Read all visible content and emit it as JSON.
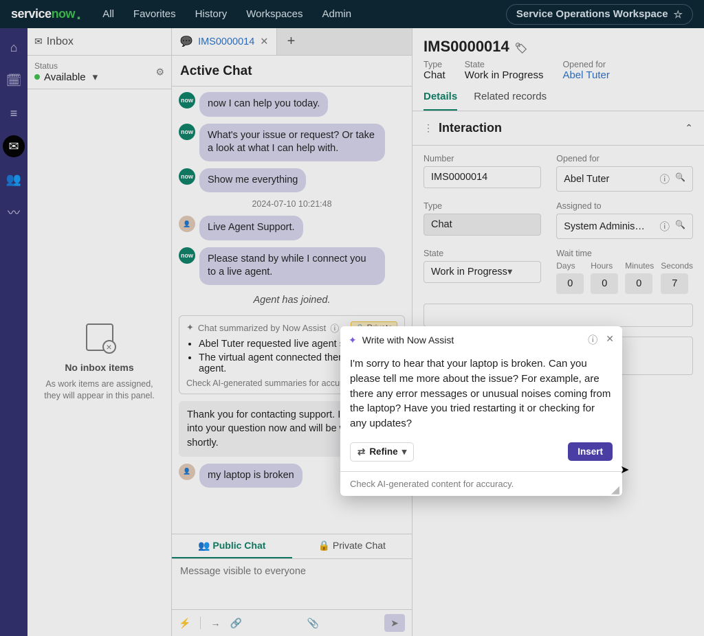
{
  "topnav": {
    "items": [
      "All",
      "Favorites",
      "History",
      "Workspaces",
      "Admin"
    ],
    "workspace_pill": "Service Operations Workspace"
  },
  "inbox": {
    "title": "Inbox",
    "status_label": "Status",
    "status_value": "Available",
    "empty_title": "No inbox items",
    "empty_sub": "As work items are assigned, they will appear in this panel."
  },
  "doctab": {
    "label": "IMS0000014"
  },
  "chat": {
    "header": "Active Chat",
    "msgs": {
      "m0": "now I can help you today.",
      "m1": "What's your issue or request? Or take a look at what I can help with.",
      "m2": "Show me everything",
      "ts": "2024-07-10 10:21:48",
      "m3": "Live Agent Support.",
      "m4": "Please stand by while I connect you to a live agent.",
      "joined": "Agent has joined.",
      "summary_head": "Chat summarized by Now Assist",
      "summary_private": "Private",
      "summary1": "Abel Tuter requested live agent support.",
      "summary2": "The virtual agent connected them to a live agent.",
      "summary_foot": "Check AI-generated summaries for accuracy",
      "m5": "Thank you for contacting support. I am looking into your question now and will be with you shortly.",
      "m6": "my laptop is broken"
    },
    "composer": {
      "tab_public": "Public Chat",
      "tab_private": "Private Chat",
      "placeholder": "Message visible to everyone"
    }
  },
  "record": {
    "title": "IMS0000014",
    "meta": {
      "type_label": "Type",
      "type_value": "Chat",
      "state_label": "State",
      "state_value": "Work in Progress",
      "opened_for_label": "Opened for",
      "opened_for_value": "Abel Tuter"
    },
    "tabs": {
      "details": "Details",
      "related": "Related records"
    },
    "section": "Interaction",
    "fields": {
      "number_label": "Number",
      "number_value": "IMS0000014",
      "opened_for_label": "Opened for",
      "opened_for_value": "Abel Tuter",
      "type_label": "Type",
      "type_value": "Chat",
      "assigned_to_label": "Assigned to",
      "assigned_to_value": "System Administrator",
      "state_label": "State",
      "state_value": "Work in Progress",
      "wait_label": "Wait time",
      "wait": {
        "days_l": "Days",
        "days": "0",
        "hours_l": "Hours",
        "hours": "0",
        "minutes_l": "Minutes",
        "minutes": "0",
        "seconds_l": "Seconds",
        "seconds": "7"
      }
    }
  },
  "popup": {
    "title": "Write with Now Assist",
    "body": "I'm sorry to hear that your laptop is broken. Can you please tell me more about the issue? For example, are there any error messages or unusual noises coming from the laptop? Have you tried restarting it or checking for any updates?",
    "refine": "Refine",
    "insert": "Insert",
    "foot": "Check AI-generated content for accuracy."
  }
}
